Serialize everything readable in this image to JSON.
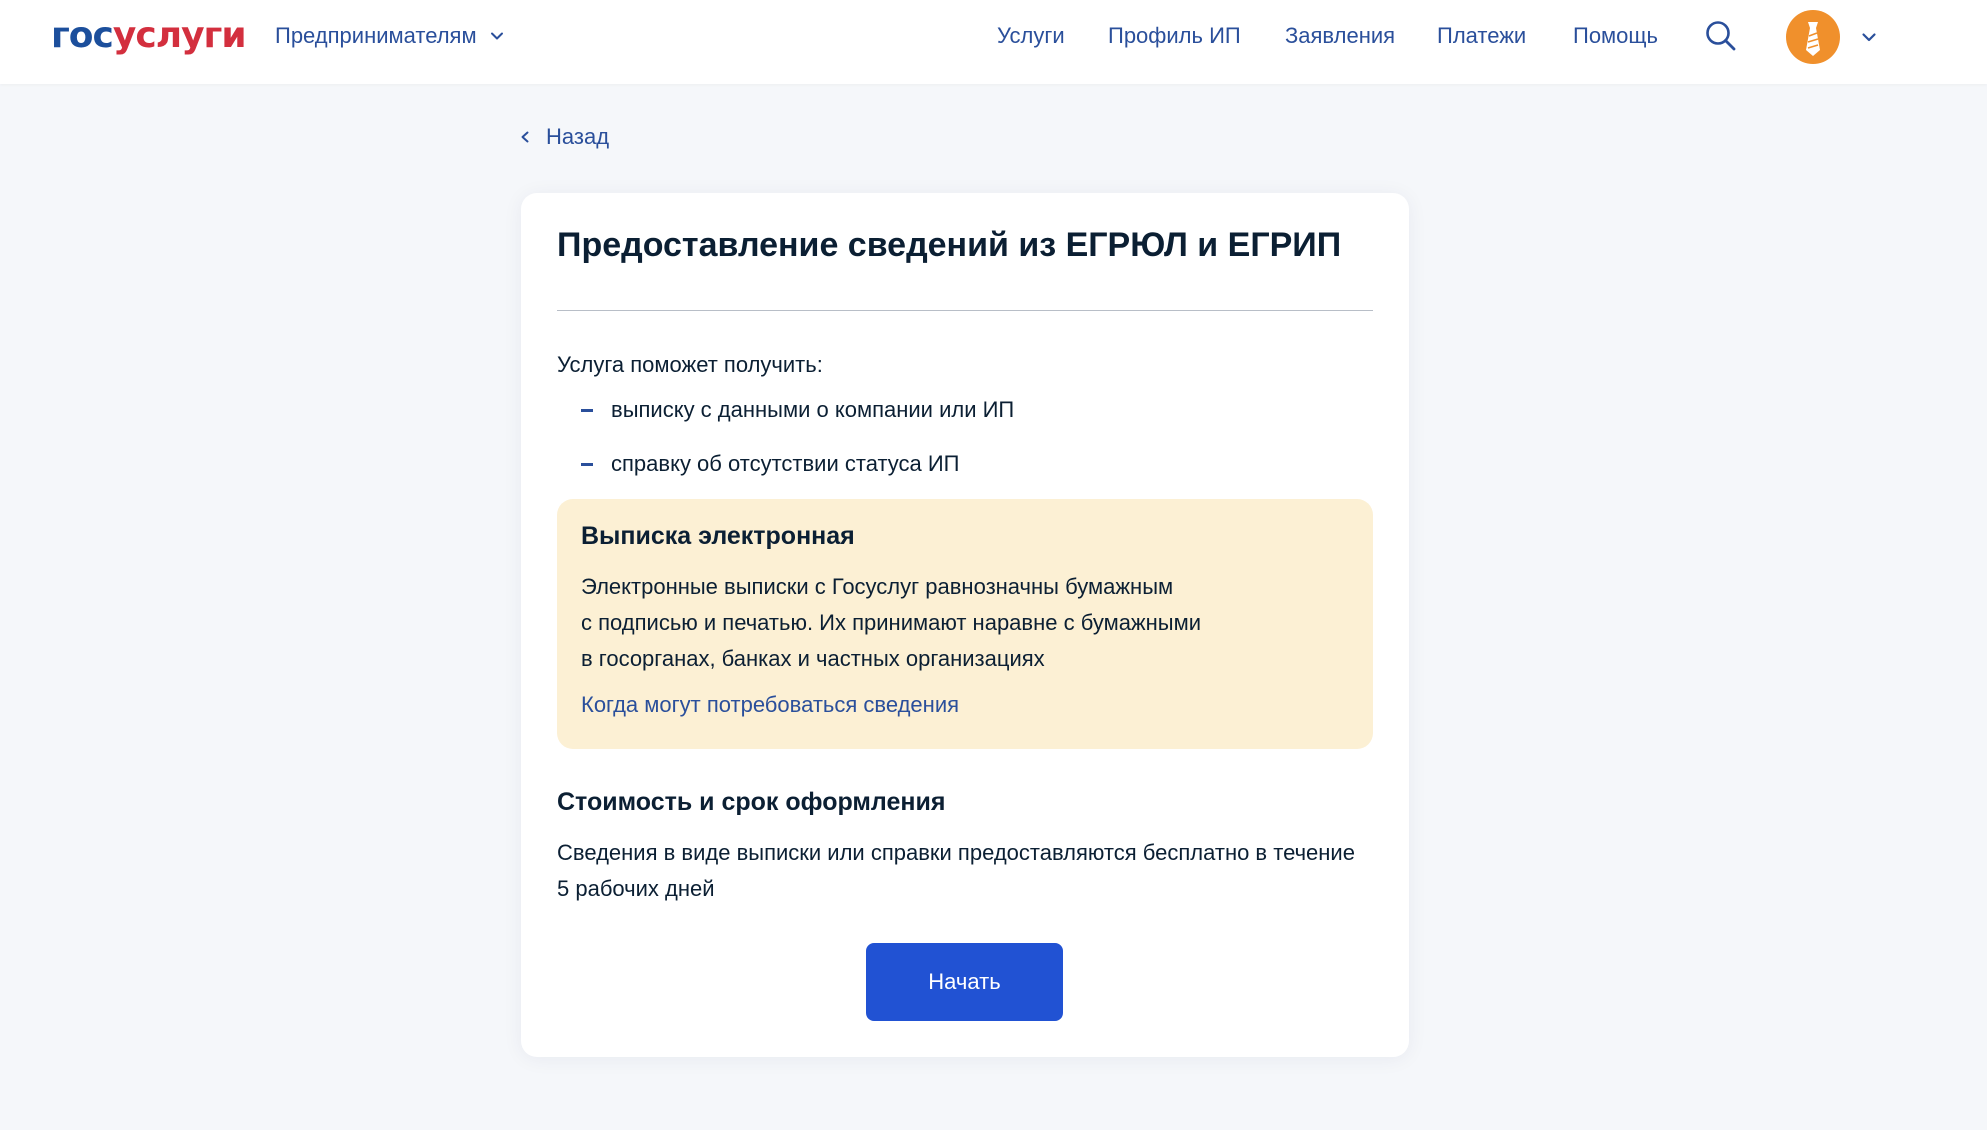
{
  "header": {
    "logo_part1": "гос",
    "logo_part2": "услуги",
    "audience_label": "Предпринимателям",
    "nav": [
      {
        "label": "Услуги"
      },
      {
        "label": "Профиль ИП"
      },
      {
        "label": "Заявления"
      },
      {
        "label": "Платежи"
      },
      {
        "label": "Помощь"
      }
    ],
    "icons": {
      "search": "search-icon",
      "avatar": "user-avatar-tie-icon",
      "avatar_menu": "chevron-down-icon",
      "audience_menu": "chevron-down-icon"
    }
  },
  "back": {
    "label": "Назад",
    "icon": "chevron-left-icon"
  },
  "card": {
    "title": "Предоставление сведений из ЕГРЮЛ и ЕГРИП",
    "intro": "Услуга поможет получить:",
    "items": [
      {
        "label": "выписку с данными о компании или ИП"
      },
      {
        "label": "справку об отсутствии статуса ИП"
      }
    ],
    "notice": {
      "title": "Выписка электронная",
      "text_lines": [
        "Электронные выписки с Госуслуг равнозначны бумажным",
        "с подписью и печатью. Их принимают наравне с бумажными",
        "в госорганах, банках и частных организациях"
      ],
      "link": "Когда могут потребоваться сведения"
    },
    "cost": {
      "title": "Стоимость и срок оформления",
      "text": "Сведения в виде выписки или справки предоставляются бесплатно в течение 5 рабочих дней"
    },
    "start_button": "Начать"
  },
  "colors": {
    "background": "#f5f7fa",
    "link": "#2a4f9b",
    "primary_button": "#2152d3",
    "notice_bg": "#fcf0d4",
    "logo_blue": "#1c4f9c",
    "logo_red": "#d32f3e",
    "avatar_bg": "#f0902c"
  }
}
